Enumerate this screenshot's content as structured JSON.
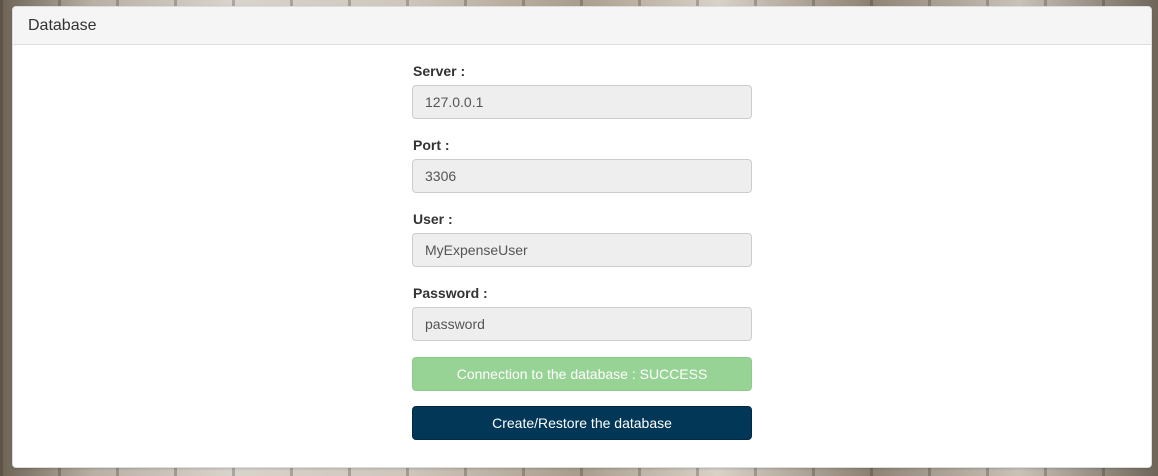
{
  "panel": {
    "title": "Database"
  },
  "form": {
    "server": {
      "label": "Server :",
      "value": "127.0.0.1"
    },
    "port": {
      "label": "Port :",
      "value": "3306"
    },
    "user": {
      "label": "User :",
      "value": "MyExpenseUser"
    },
    "password": {
      "label": "Password :",
      "value": "password"
    }
  },
  "status": {
    "text": "Connection to the database : SUCCESS",
    "color": "#98d396"
  },
  "action": {
    "label": "Create/Restore the database",
    "color": "#023757"
  }
}
